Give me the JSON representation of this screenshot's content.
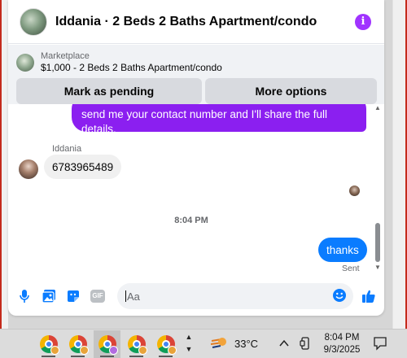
{
  "header": {
    "title": "Iddania · 2 Beds 2 Baths Apartment/condo",
    "info_icon": "i"
  },
  "marketplace": {
    "label": "Marketplace",
    "listing": "$1,000 - 2 Beds 2 Baths Apartment/condo",
    "pending_button": "Mark as pending",
    "more_button": "More options"
  },
  "messages": {
    "outgoing_partial": "send me your contact number and I'll share the full details.",
    "sender_name": "Iddania",
    "incoming_text": "6783965489",
    "timestamp": "8:04 PM",
    "outgoing_text": "thanks",
    "status": "Sent"
  },
  "composer": {
    "placeholder": "Aa",
    "gif_label": "GIF"
  },
  "taskbar": {
    "temperature": "33°C",
    "time": "8:04 PM",
    "date": "9/3/2025",
    "profile_colors": [
      "#e8a33a",
      "#e8a33a",
      "#b26be0",
      "#e8a33a",
      "#e8a33a"
    ]
  },
  "colors": {
    "accent_purple": "#8b1ff0",
    "messenger_blue": "#0a7cff",
    "info_purple": "#a033ff"
  }
}
